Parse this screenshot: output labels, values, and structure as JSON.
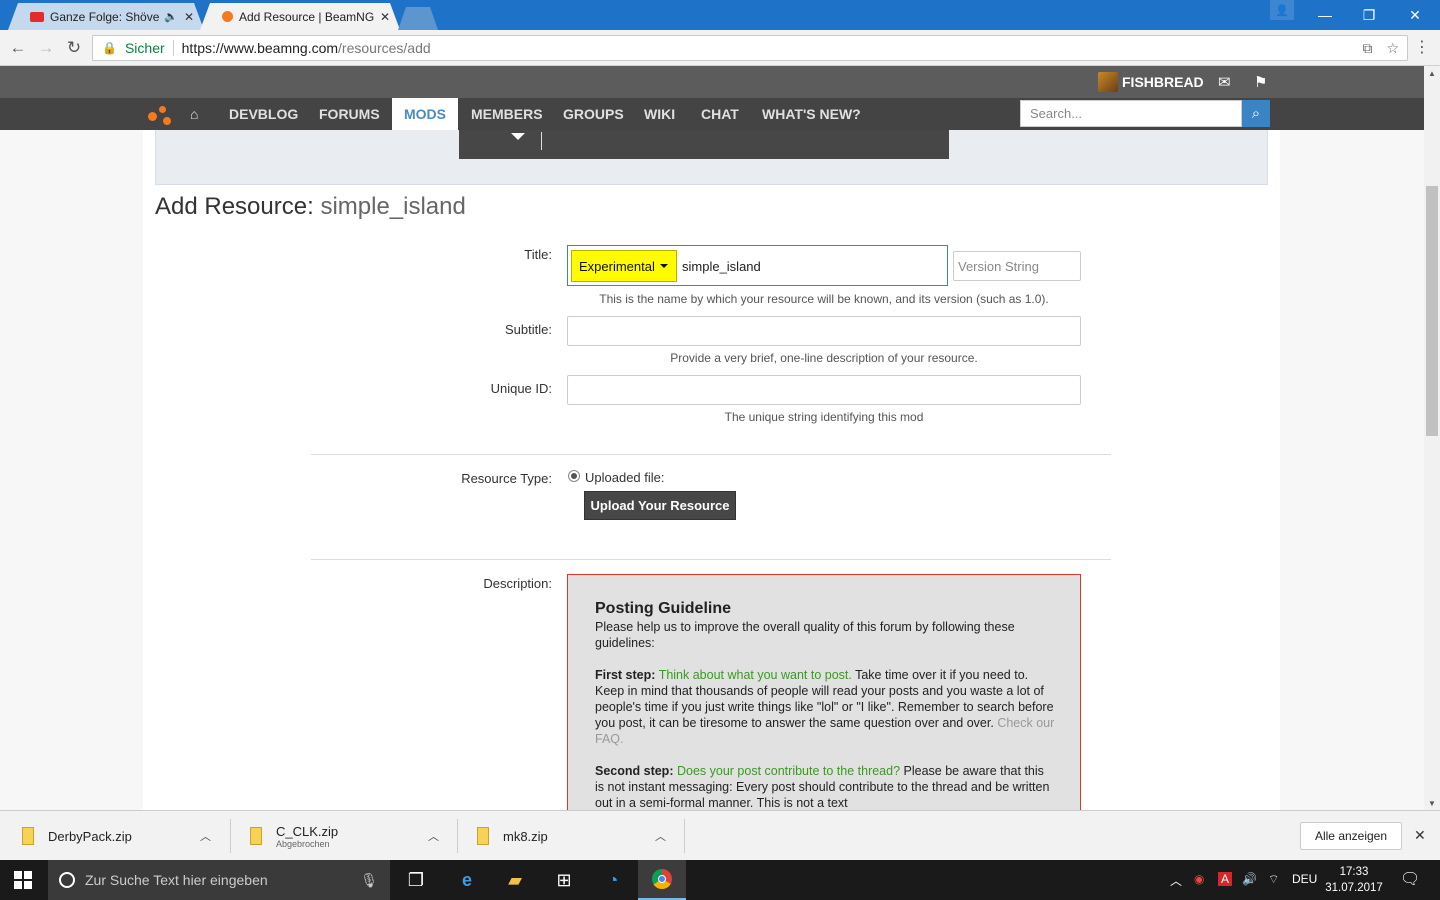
{
  "browser": {
    "tabs": [
      {
        "title": "Ganze Folge: Shövenp",
        "favicon_color": "#e22b2b"
      },
      {
        "title": "Add Resource | BeamNG",
        "favicon_color": "#f47a1f"
      }
    ],
    "secure_label": "Sicher",
    "url_host": "https://www.beamng.com",
    "url_path": "/resources/add"
  },
  "site": {
    "username": "FISHBREAD",
    "nav": [
      "DEVBLOG",
      "FORUMS",
      "MODS",
      "MEMBERS",
      "GROUPS",
      "WIKI",
      "CHAT",
      "WHAT'S NEW?"
    ],
    "active_nav": "MODS",
    "search_placeholder": "Search..."
  },
  "page": {
    "title_prefix": "Add Resource:",
    "title_name": "simple_island",
    "form": {
      "title_label": "Title:",
      "prefix": "Experimental",
      "title_value": "simple_island",
      "version_placeholder": "Version String",
      "title_hint": "This is the name by which your resource will be known, and its version (such as 1.0).",
      "subtitle_label": "Subtitle:",
      "subtitle_hint": "Provide a very brief, one-line description of your resource.",
      "unique_label": "Unique ID:",
      "unique_hint": "The unique string identifying this mod",
      "type_label": "Resource Type:",
      "type_option": "Uploaded file:",
      "upload_button": "Upload Your Resource",
      "description_label": "Description:"
    },
    "guideline": {
      "heading": "Posting Guideline",
      "intro": "Please help us to improve the overall quality of this forum by following these guidelines:",
      "step1_label": "First step:",
      "step1_green": "Think about what you want to post.",
      "step1_text": "Take time over it if you need to. Keep in mind that thousands of people will read your posts and you waste a lot of people's time if you just write things like \"lol\" or \"I like\". Remember to search before you post, it can be tiresome to answer the same question over and over.",
      "step1_link": "Check our FAQ.",
      "step2_label": "Second step:",
      "step2_green": "Does your post contribute to the thread?",
      "step2_text": "Please be aware that this is not instant messaging: Every post should contribute to the thread and be written out in a semi-formal manner. This is not a text"
    }
  },
  "downloads": [
    {
      "name": "DerbyPack.zip",
      "status": ""
    },
    {
      "name": "C_CLK.zip",
      "status": "Abgebrochen"
    },
    {
      "name": "mk8.zip",
      "status": ""
    }
  ],
  "downloads_show_all": "Alle anzeigen",
  "taskbar": {
    "search_placeholder": "Zur Suche Text hier eingeben",
    "language": "DEU",
    "time": "17:33",
    "date": "31.07.2017"
  },
  "colors": {
    "accent": "#3b84c4",
    "prefix_highlight": "#fffb00",
    "guideline_border": "#d9382e",
    "guideline_green": "#3a9a22"
  }
}
